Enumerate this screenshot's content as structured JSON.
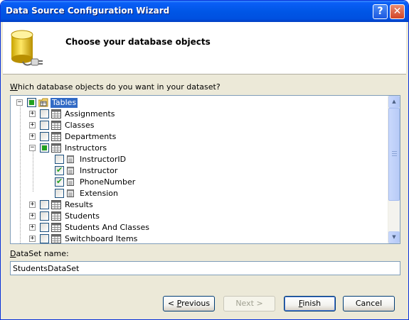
{
  "window": {
    "title": "Data Source Configuration Wizard",
    "help_glyph": "?",
    "close_glyph": "✕"
  },
  "header": {
    "title": "Choose your database objects",
    "icon": "database-plug-icon"
  },
  "prompt": {
    "accel": "W",
    "rest": "hich database objects do you want in your dataset?"
  },
  "tree": {
    "rows": [
      {
        "label": "Tables",
        "expander": "−",
        "state": "partial",
        "icon": "tables-folder-icon",
        "selected": true
      },
      {
        "label": "Assignments",
        "expander": "+",
        "state": "unchecked",
        "icon": "table-icon"
      },
      {
        "label": "Classes",
        "expander": "+",
        "state": "unchecked",
        "icon": "table-icon"
      },
      {
        "label": "Departments",
        "expander": "+",
        "state": "unchecked",
        "icon": "table-icon"
      },
      {
        "label": "Instructors",
        "expander": "−",
        "state": "partial",
        "icon": "table-icon"
      },
      {
        "label": "InstructorID",
        "state": "unchecked",
        "icon": "column-icon"
      },
      {
        "label": "Instructor",
        "state": "checked",
        "icon": "column-icon"
      },
      {
        "label": "PhoneNumber",
        "state": "checked",
        "icon": "column-icon"
      },
      {
        "label": "Extension",
        "state": "unchecked",
        "icon": "column-icon"
      },
      {
        "label": "Results",
        "expander": "+",
        "state": "unchecked",
        "icon": "table-icon"
      },
      {
        "label": "Students",
        "expander": "+",
        "state": "unchecked",
        "icon": "table-icon"
      },
      {
        "label": "Students And Classes",
        "expander": "+",
        "state": "unchecked",
        "icon": "table-icon"
      },
      {
        "label": "Switchboard Items",
        "expander": "+",
        "state": "unchecked",
        "icon": "table-icon"
      }
    ],
    "scroll_up_glyph": "▲",
    "scroll_down_glyph": "▼"
  },
  "dataset": {
    "label_accel": "D",
    "label_rest": "ataSet name:",
    "value": "StudentsDataSet"
  },
  "buttons": {
    "previous_pre": "< ",
    "previous_accel": "P",
    "previous_rest": "revious",
    "next_label": "Next >",
    "finish_accel": "F",
    "finish_rest": "inish",
    "cancel_label": "Cancel"
  },
  "colors": {
    "title_bar": "#0054e3",
    "selection": "#316ac5",
    "check_green": "#21a121",
    "dialog_bg": "#ece9d8"
  }
}
